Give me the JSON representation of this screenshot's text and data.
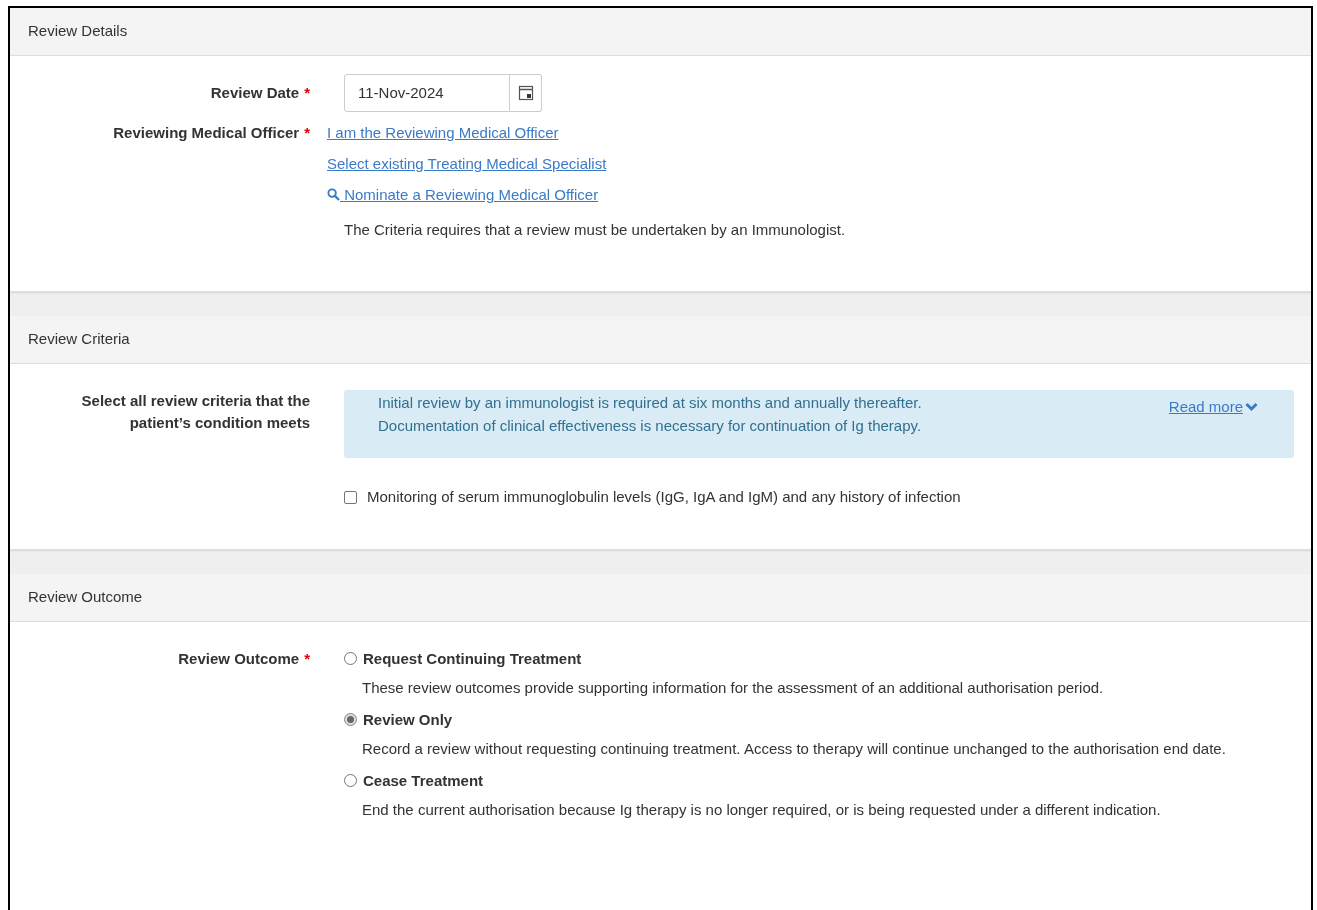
{
  "sections": [
    {
      "title": "Review Details",
      "kind": "details",
      "review_date": {
        "label": "Review Date",
        "required_mark": "*",
        "value": "11-Nov-2024"
      },
      "reviewing_officer": {
        "label": "Reviewing Medical Officer",
        "required_mark": "*",
        "links": [
          {
            "text": "I am the Reviewing Medical Officer",
            "kind": "plain"
          },
          {
            "text": "Select existing Treating Medical Specialist",
            "kind": "plain"
          },
          {
            "text": " Nominate a Reviewing Medical Officer",
            "kind": "search"
          }
        ],
        "note": "The Criteria requires that a review must be undertaken by an Immunologist."
      }
    },
    {
      "title": "Review Criteria",
      "kind": "criteria",
      "label": "Select all review criteria that the patient’s condition meets",
      "info": {
        "lines": [
          "Initial review by an immunologist is required at six months and annually thereafter.",
          "Documentation of clinical effectiveness is necessary for continuation of Ig therapy."
        ],
        "link": "Read more"
      },
      "criteria": [
        {
          "text": "Monitoring of serum immunoglobulin levels (IgG, IgA and IgM) and any history of infection",
          "checked": false
        }
      ]
    },
    {
      "title": "Review Outcome",
      "kind": "outcome",
      "label": "Review Outcome",
      "required_mark": "*",
      "options": [
        {
          "label": "Request Continuing Treatment",
          "description": "These review outcomes provide supporting information for the assessment of an additional authorisation period.",
          "selected": false
        },
        {
          "label": "Review Only",
          "description": "Record a review without requesting continuing treatment. Access to therapy will continue unchanged to the authorisation end date.",
          "selected": true
        },
        {
          "label": "Cease Treatment",
          "description": "End the current authorisation because Ig therapy is no longer required, or is being requested under a different indication.",
          "selected": false
        }
      ]
    }
  ]
}
